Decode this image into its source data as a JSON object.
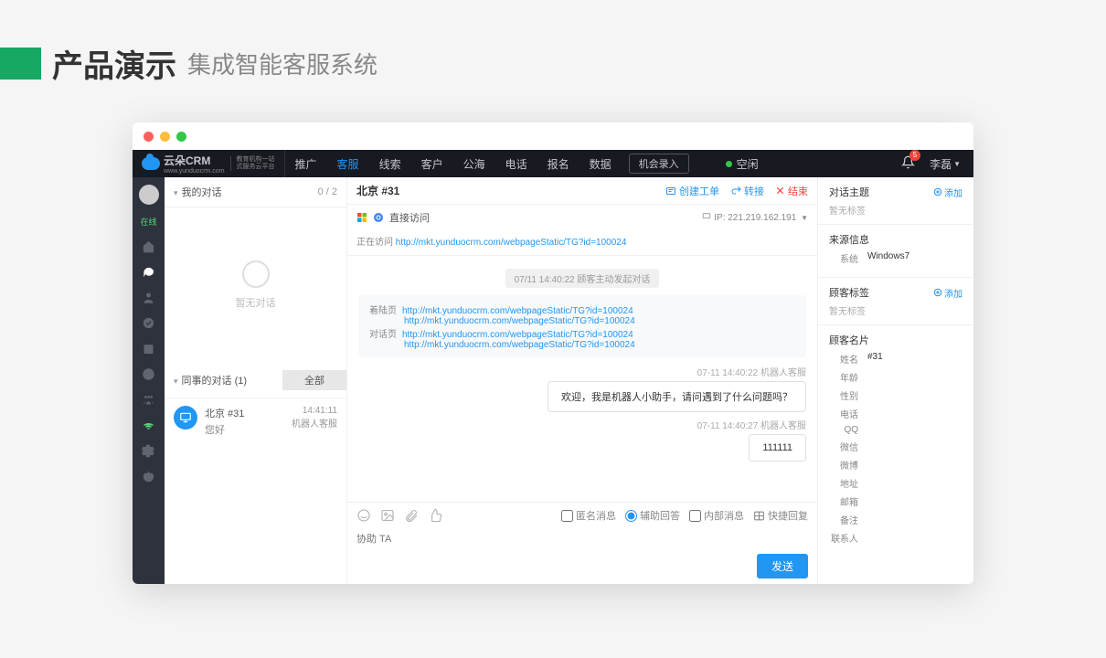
{
  "slide": {
    "main": "产品演示",
    "sub": "集成智能客服系统"
  },
  "brand": {
    "name": "云朵CRM",
    "url": "www.yunduocrm.com",
    "slogan1": "教育机构一站",
    "slogan2": "式服务云平台"
  },
  "nav": {
    "items": [
      "推广",
      "客服",
      "线索",
      "客户",
      "公海",
      "电话",
      "报名",
      "数据"
    ],
    "active_index": 1,
    "record_btn": "机会录入"
  },
  "status": {
    "label": "空闲"
  },
  "user": {
    "name": "李磊",
    "notif_count": "5"
  },
  "rail": {
    "online": "在线"
  },
  "my_conv": {
    "title": "我的对话",
    "count": "0 / 2",
    "empty": "暂无对话"
  },
  "peer_conv": {
    "title": "同事的对话  (1)",
    "all_btn": "全部"
  },
  "conv_item": {
    "name": "北京  #31",
    "preview": "您好",
    "time": "14:41:11",
    "agent": "机器人客服"
  },
  "chat": {
    "title": "北京 #31",
    "actions": {
      "ticket": "创建工单",
      "transfer": "转接",
      "end": "结束"
    },
    "access_label": "直接访问",
    "ip_label": "IP:",
    "ip": "221.219.162.191",
    "visiting_label": "正在访问",
    "visiting_url": "http://mkt.yunduocrm.com/webpageStatic/TG?id=100024",
    "timeline_note": "07/11 14:40:22  顾客主动发起对话",
    "land_label": "着陆页",
    "chat_page_label": "对话页",
    "urls": [
      "http://mkt.yunduocrm.com/webpageStatic/TG?id=100024",
      "http://mkt.yunduocrm.com/webpageStatic/TG?id=100024",
      "http://mkt.yunduocrm.com/webpageStatic/TG?id=100024",
      "http://mkt.yunduocrm.com/webpageStatic/TG?id=100024"
    ],
    "m1_time": "07-11 14:40:22  机器人客服",
    "m1_text": "欢迎，我是机器人小助手，请问遇到了什么问题吗？",
    "m2_time": "07-11 14:40:27  机器人客服",
    "m2_text": "111111",
    "opts": {
      "anon": "匿名消息",
      "assist": "辅助回答",
      "internal": "内部消息",
      "quick": "快捷回复"
    },
    "placeholder": "协助 TA",
    "send": "发送"
  },
  "right": {
    "topic_title": "对话主题",
    "add": "添加",
    "none_tag": "暂无标签",
    "source_title": "来源信息",
    "sys_label": "系统",
    "sys_val": "Windows7",
    "tag_title": "顾客标签",
    "card_title": "顾客名片",
    "card": {
      "name_lbl": "姓名",
      "name_val": "#31",
      "age": "年龄",
      "sex": "性别",
      "phone": "电话",
      "qq": "QQ",
      "wechat": "微信",
      "weibo": "微博",
      "addr": "地址",
      "mail": "邮箱",
      "note": "备注",
      "contact": "联系人"
    }
  }
}
